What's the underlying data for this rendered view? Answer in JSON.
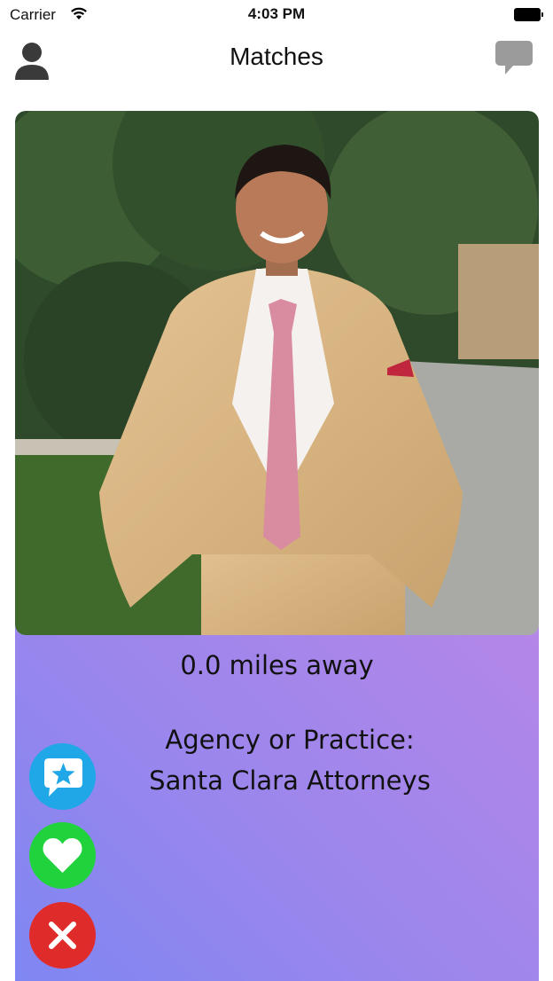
{
  "status_bar": {
    "carrier": "Carrier",
    "time": "4:03 PM",
    "wifi_icon": "wifi-icon",
    "battery_icon": "battery-icon"
  },
  "nav": {
    "title": "Matches",
    "left_icon": "profile-icon",
    "right_icon": "chat-bubble-icon"
  },
  "card": {
    "photo": "profile-photo",
    "distance": "0.0 miles away",
    "agency_label": "Agency or Practice:",
    "agency_value": "Santa Clara Attorneys",
    "gradient_start": "#7f86f2",
    "gradient_end": "#b486e8"
  },
  "actions": [
    {
      "name": "superlike",
      "icon": "star-message-icon",
      "color": "#1fa7e8"
    },
    {
      "name": "like",
      "icon": "heart-icon",
      "color": "#20d23c"
    },
    {
      "name": "dislike",
      "icon": "close-icon",
      "color": "#e02b2b"
    }
  ]
}
